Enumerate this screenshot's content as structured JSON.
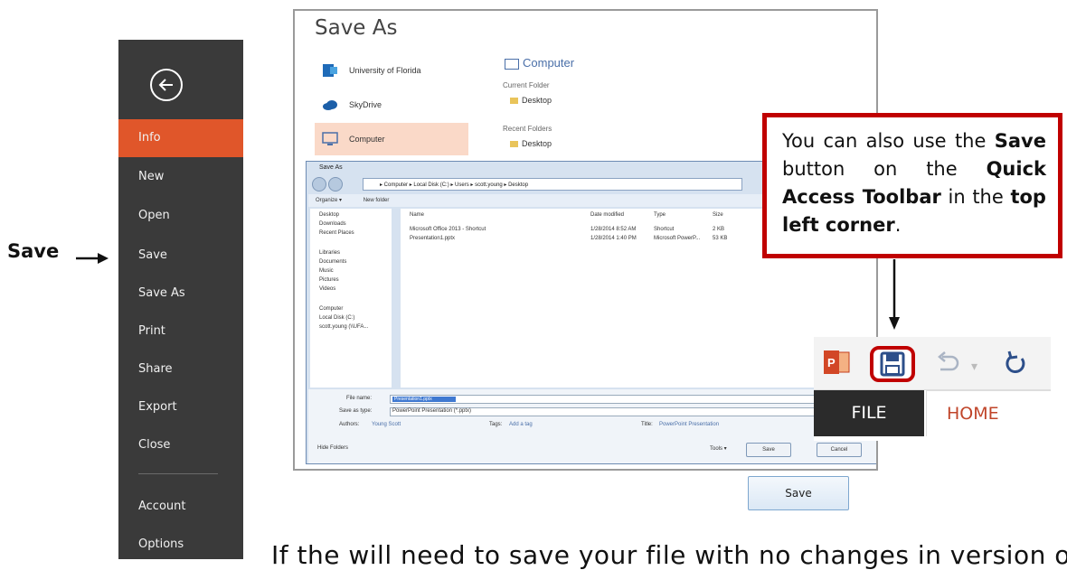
{
  "left_label": {
    "text": "Save"
  },
  "sidebar": {
    "items": [
      {
        "label": "Info",
        "active": true
      },
      {
        "label": "New"
      },
      {
        "label": "Open"
      },
      {
        "label": "Save"
      },
      {
        "label": "Save As"
      },
      {
        "label": "Print"
      },
      {
        "label": "Share"
      },
      {
        "label": "Export"
      },
      {
        "label": "Close"
      },
      {
        "label": "Account"
      },
      {
        "label": "Options"
      }
    ],
    "accent_color": "#e0562a"
  },
  "backstage": {
    "title": "Save As",
    "places": [
      {
        "label": "University of Florida",
        "icon": "sharepoint-icon"
      },
      {
        "label": "SkyDrive",
        "icon": "skydrive-icon"
      },
      {
        "label": "Computer",
        "icon": "computer-icon",
        "active": true
      }
    ],
    "computer_heading": "Computer",
    "current_folder_label": "Current Folder",
    "current_folder": "Desktop",
    "recent_folders_label": "Recent Folders",
    "recent_folder": "Desktop"
  },
  "dialog": {
    "title": "Save As",
    "address": "▸ Computer ▸ Local Disk (C:) ▸ Users ▸ scott.young ▸ Desktop",
    "toolbar": {
      "organize": "Organize ▾",
      "new_folder": "New folder"
    },
    "nav": [
      "Desktop",
      "Downloads",
      "Recent Places",
      "Libraries",
      "Documents",
      "Music",
      "Pictures",
      "Videos",
      "Computer",
      "Local Disk (C:)",
      "scott.young (\\\\UFA..."
    ],
    "columns": [
      "Name",
      "Date modified",
      "Type",
      "Size"
    ],
    "rows": [
      [
        "Microsoft Office 2013 - Shortcut",
        "1/28/2014 8:52 AM",
        "Shortcut",
        "2 KB"
      ],
      [
        "Presentation1.pptx",
        "1/28/2014 1:40 PM",
        "Microsoft PowerP...",
        "53 KB"
      ]
    ],
    "file_name_label": "File name:",
    "file_name": "Presentation1.pptx",
    "save_type_label": "Save as type:",
    "save_type": "PowerPoint Presentation (*.pptx)",
    "authors_label": "Authors:",
    "authors": "Young Scott",
    "tags_label": "Tags:",
    "tags": "Add a tag",
    "doc_title_label": "Title:",
    "doc_title": "PowerPoint Presentation",
    "hide_folders": "Hide Folders",
    "tools": "Tools ▾",
    "save_btn": "Save",
    "cancel_btn": "Cancel"
  },
  "callout": {
    "part1": "You can also use the",
    "save_word": "Save",
    "part2": "button on the",
    "qat": "Quick Access Toolbar",
    "part3": "in the",
    "corner": "top left corner",
    "period": ".",
    "border_color": "#c00000"
  },
  "qat": {
    "file_tab": "FILE",
    "home_tab": "HOME",
    "undo_dropdown": "▾"
  },
  "big_save_button": {
    "label": "Save"
  },
  "bottom_text": "If the will need to save your file with no changes in version of"
}
